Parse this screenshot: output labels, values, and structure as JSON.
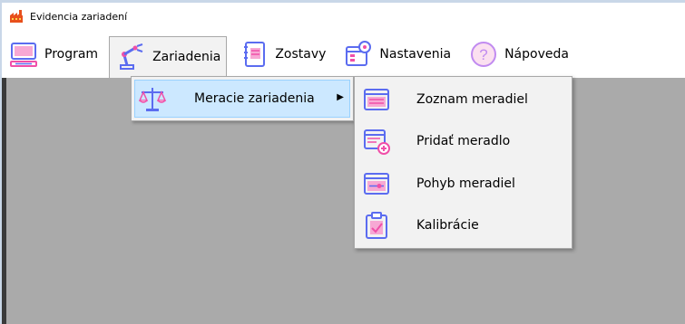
{
  "window": {
    "title": "Evidencia zariadení"
  },
  "menubar": {
    "items": [
      {
        "label": "Program",
        "icon": "computer-icon"
      },
      {
        "label": "Zariadenia",
        "icon": "robot-arm-icon",
        "active": true
      },
      {
        "label": "Zostavy",
        "icon": "notebook-icon"
      },
      {
        "label": "Nastavenia",
        "icon": "settings-window-icon"
      },
      {
        "label": "Nápoveda",
        "icon": "help-icon"
      }
    ]
  },
  "submenu": {
    "label": "Meracie zariadenia",
    "icon": "scale-icon",
    "items": [
      {
        "label": "Zoznam meradiel",
        "icon": "list-window-icon"
      },
      {
        "label": "Pridať meradlo",
        "icon": "add-window-icon"
      },
      {
        "label": "Pohyb meradiel",
        "icon": "slider-window-icon"
      },
      {
        "label": "Kalibrácie",
        "icon": "clipboard-check-icon"
      }
    ]
  },
  "colors": {
    "icon_primary": "#5b6cf0",
    "icon_accent": "#f04fa8",
    "workarea": "#aaaaaa",
    "highlight": "#cce8ff"
  }
}
